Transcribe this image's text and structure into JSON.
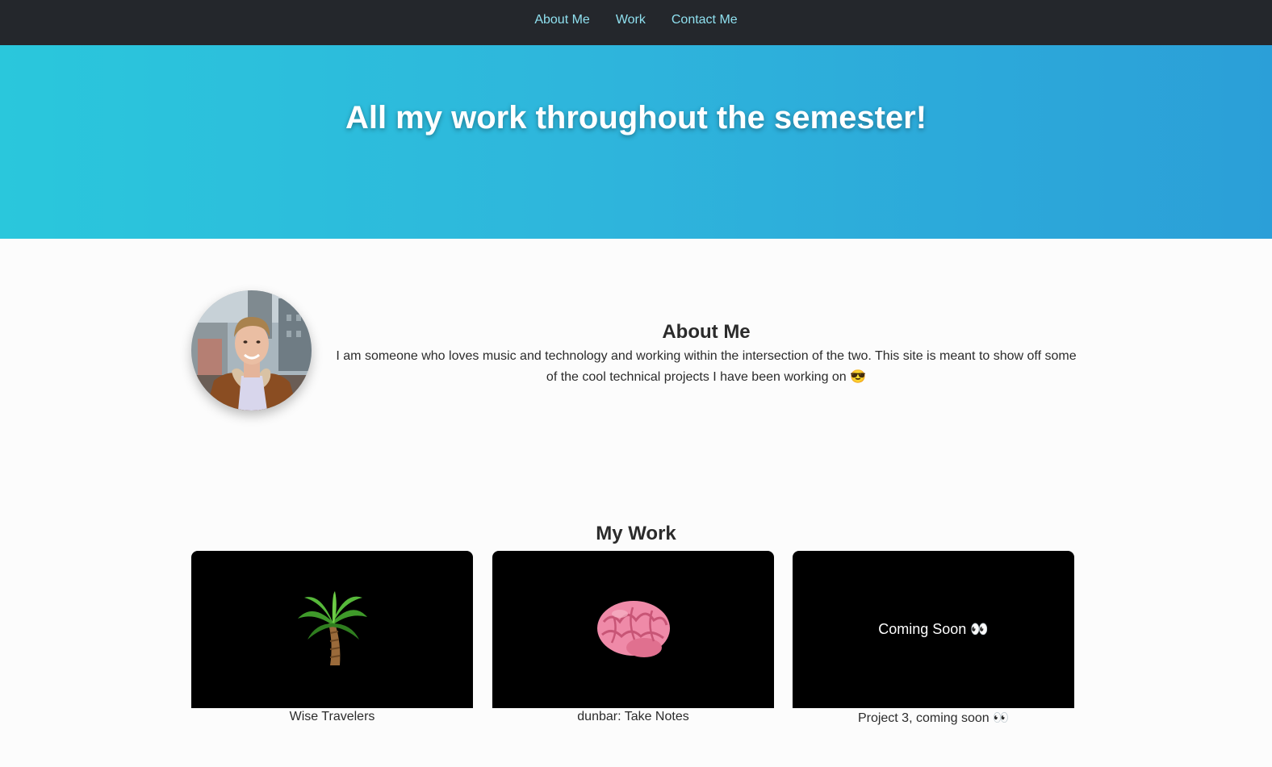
{
  "nav": {
    "links": [
      "About Me",
      "Work",
      "Contact Me"
    ],
    "link_color": "#8fe0ef",
    "background": "#24272c"
  },
  "hero": {
    "title": "All my work throughout the semester!",
    "gradient": [
      "#2ac7dc",
      "#2b9fd8"
    ]
  },
  "about": {
    "heading": "About Me",
    "text": "I am someone who loves music and technology and working within the intersection of the two. This site is meant to show off some of the cool technical projects I have been working on 😎",
    "avatar_icon": "profile-photo"
  },
  "work": {
    "heading": "My Work",
    "projects": [
      {
        "caption": "Wise Travelers",
        "thumbnail": "palm-tree-icon"
      },
      {
        "caption": "dunbar: Take Notes",
        "thumbnail": "brain-icon"
      },
      {
        "caption": "Project 3, coming soon 👀",
        "thumbnail_text": "Coming Soon 👀"
      }
    ]
  }
}
